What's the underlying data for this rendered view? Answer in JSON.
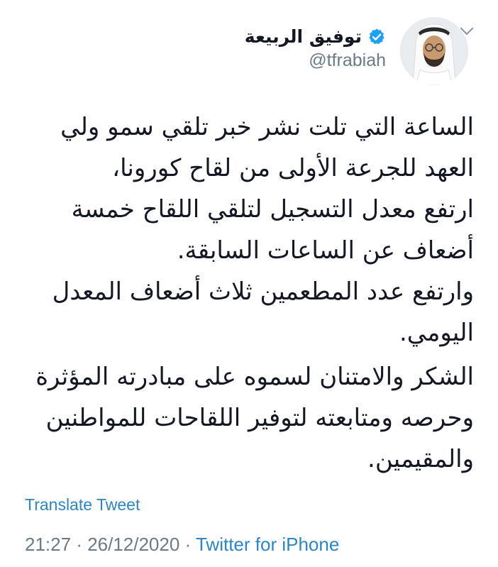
{
  "author": {
    "display_name": "توفيق الربيعة",
    "handle": "@tfrabiah",
    "verified": true,
    "avatar_icon": "profile-photo"
  },
  "tweet": {
    "lines": [
      "الساعة التي تلت نشر خبر تلقي سمو ولي",
      "العهد للجرعة الأولى من لقاح كورونا،",
      "ارتفع معدل التسجيل لتلقي اللقاح خمسة",
      "أضعاف عن الساعات السابقة.",
      "وارتفع عدد المطعمين ثلاث أضعاف المعدل",
      "اليومي.",
      "الشكر والامتنان لسموه على مبادرته المؤثرة",
      "وحرصه ومتابعته لتوفير اللقاحات للمواطنين",
      "والمقيمين."
    ]
  },
  "actions": {
    "translate_label": "Translate Tweet",
    "menu_icon": "chevron-down-icon"
  },
  "meta": {
    "time": "21:27",
    "separator1": " · ",
    "date": "26/12/2020",
    "separator2": " · ",
    "source": "Twitter for iPhone"
  },
  "colors": {
    "link": "#2b86c5",
    "muted": "#6a7a87",
    "text": "#141823",
    "verified_badge": "#1da1f2"
  }
}
